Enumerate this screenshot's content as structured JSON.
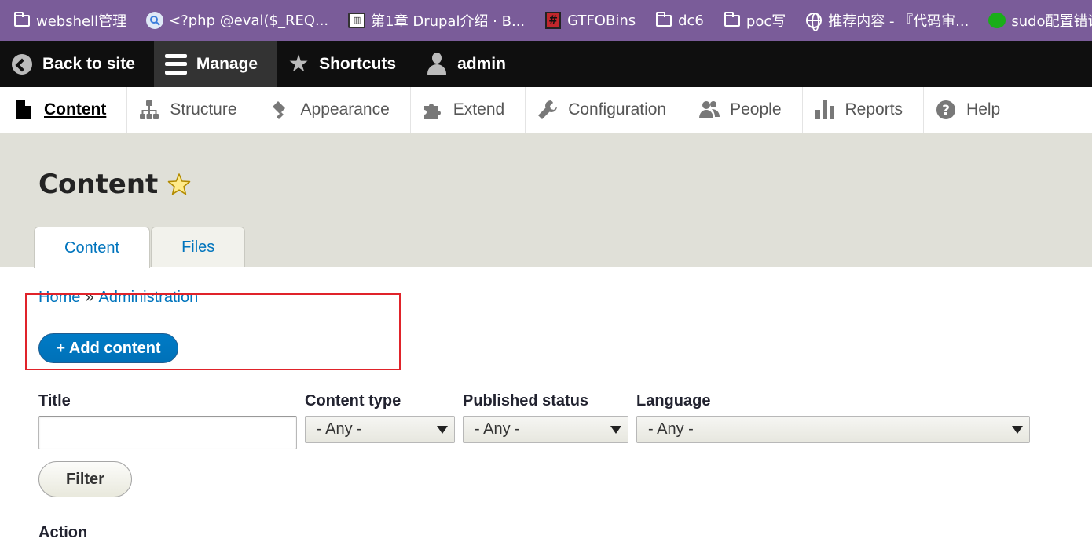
{
  "bookmarks": [
    {
      "label": "webshell管理",
      "icon": "folder-icon"
    },
    {
      "label": "<?php @eval($_REQ...",
      "icon": "search-icon"
    },
    {
      "label": "第1章 Drupal介绍 · B...",
      "icon": "book-icon"
    },
    {
      "label": "GTFOBins",
      "icon": "gtfobins-icon"
    },
    {
      "label": "dc6",
      "icon": "folder-icon"
    },
    {
      "label": "poc写",
      "icon": "folder-icon"
    },
    {
      "label": "推荐内容 - 『代码审...",
      "icon": "globe-icon"
    },
    {
      "label": "sudo配置错误提权号",
      "icon": "wechat-icon"
    }
  ],
  "toolbar": {
    "back_label": "Back to site",
    "manage_label": "Manage",
    "shortcuts_label": "Shortcuts",
    "user_label": "admin"
  },
  "tray": {
    "items": [
      {
        "label": "Content",
        "icon": "document-icon",
        "active": true
      },
      {
        "label": "Structure",
        "icon": "sitemap-icon"
      },
      {
        "label": "Appearance",
        "icon": "paint-icon"
      },
      {
        "label": "Extend",
        "icon": "puzzle-icon"
      },
      {
        "label": "Configuration",
        "icon": "wrench-icon"
      },
      {
        "label": "People",
        "icon": "people-icon"
      },
      {
        "label": "Reports",
        "icon": "bar-chart-icon"
      },
      {
        "label": "Help",
        "icon": "help-icon"
      }
    ]
  },
  "page": {
    "title": "Content",
    "tabs": [
      {
        "label": "Content",
        "active": true
      },
      {
        "label": "Files"
      }
    ]
  },
  "breadcrumb": {
    "home": "Home",
    "separator": "»",
    "admin": "Administration"
  },
  "add_content_label": "+ Add content",
  "filters": {
    "title_label": "Title",
    "title_value": "",
    "content_type_label": "Content type",
    "content_type_value": "- Any -",
    "published_label": "Published status",
    "published_value": "- Any -",
    "language_label": "Language",
    "language_value": "- Any -",
    "filter_button": "Filter"
  },
  "action_label": "Action",
  "colors": {
    "bookmark_bar": "#7a5c99",
    "toolbar": "#0f0f0f",
    "link": "#0074bd",
    "primary_button": "#0071b8",
    "highlight_box": "#e0232a"
  }
}
